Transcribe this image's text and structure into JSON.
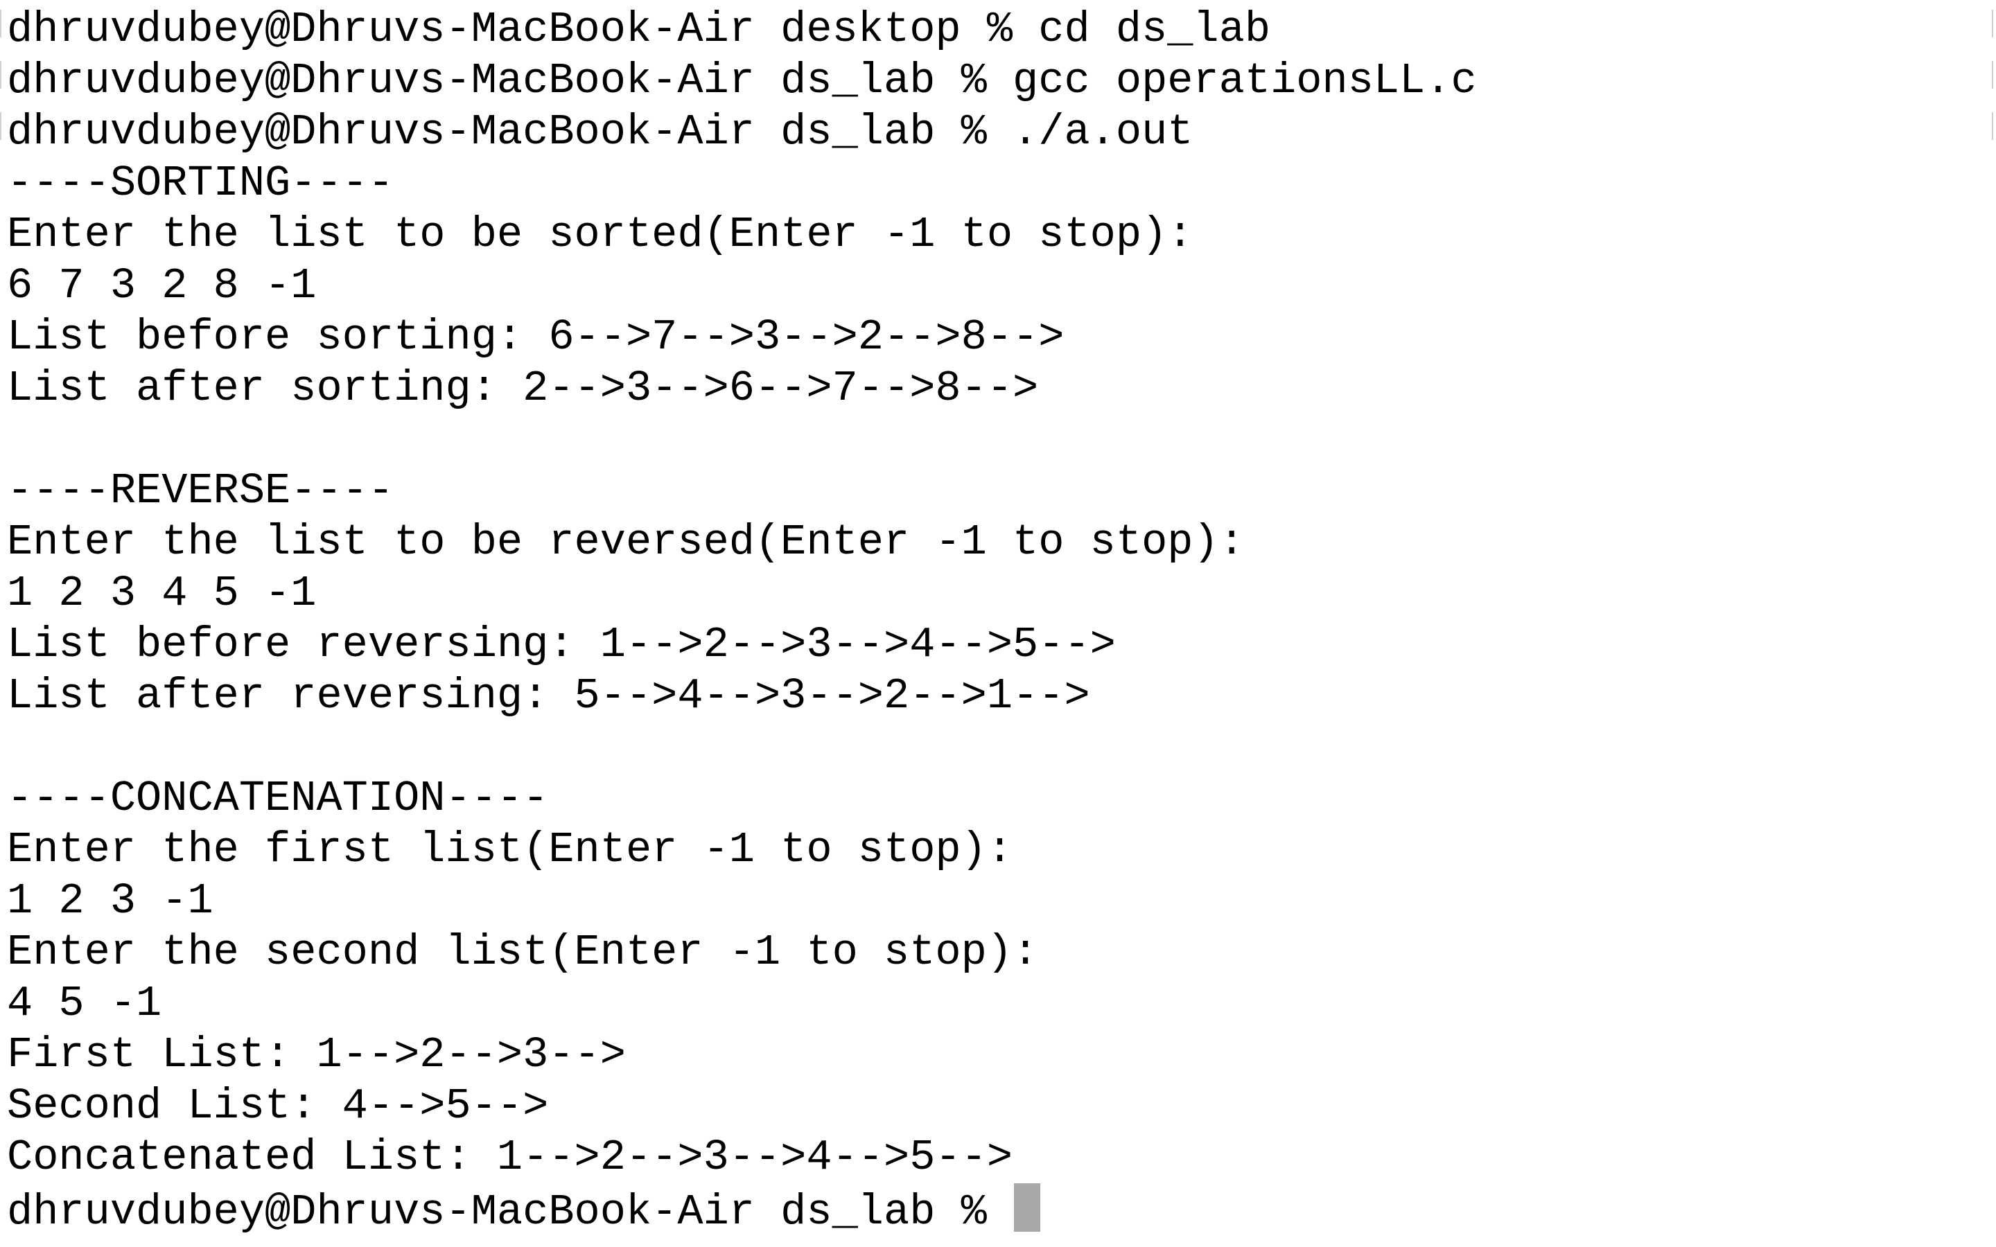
{
  "terminal": {
    "lines": [
      "dhruvdubey@Dhruvs-MacBook-Air desktop % cd ds_lab",
      "dhruvdubey@Dhruvs-MacBook-Air ds_lab % gcc operationsLL.c",
      "dhruvdubey@Dhruvs-MacBook-Air ds_lab % ./a.out",
      "----SORTING----",
      "Enter the list to be sorted(Enter -1 to stop):",
      "6 7 3 2 8 -1",
      "List before sorting: 6-->7-->3-->2-->8-->",
      "List after sorting: 2-->3-->6-->7-->8-->",
      "",
      "----REVERSE----",
      "Enter the list to be reversed(Enter -1 to stop):",
      "1 2 3 4 5 -1",
      "List before reversing: 1-->2-->3-->4-->5-->",
      "List after reversing: 5-->4-->3-->2-->1-->",
      "",
      "----CONCATENATION----",
      "Enter the first list(Enter -1 to stop):",
      "1 2 3 -1",
      "Enter the second list(Enter -1 to stop):",
      "4 5 -1",
      "First List: 1-->2-->3-->",
      "Second List: 4-->5-->",
      "Concatenated List: 1-->2-->3-->4-->5-->"
    ],
    "prompt": "dhruvdubey@Dhruvs-MacBook-Air ds_lab % "
  },
  "colors": {
    "background": "#ffffff",
    "text": "#000000",
    "cursor": "#a8a8a8",
    "edge_mark": "#d0d0d0"
  }
}
